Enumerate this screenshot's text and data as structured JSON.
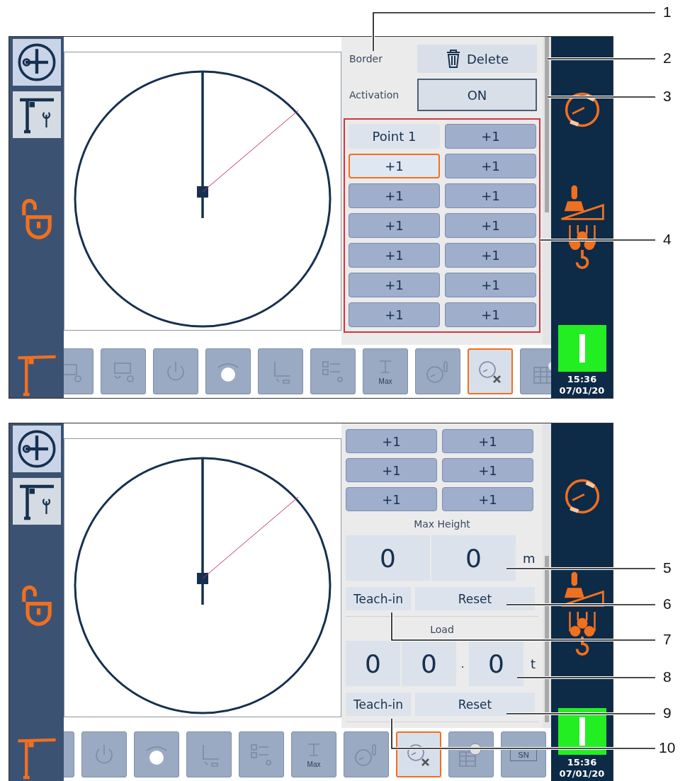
{
  "screens": [
    {
      "sidebar": [
        {
          "selected": true
        },
        {
          "selected": false
        }
      ],
      "panel": {
        "sections": [
          {
            "kind": "action_row",
            "label": "Border",
            "button": "Delete"
          },
          {
            "kind": "toggle_row",
            "label": "Activation",
            "value": "ON"
          },
          {
            "kind": "point_grid",
            "outlined": true,
            "cells": [
              {
                "label": "Point 1",
                "kind": "name",
                "selected": false
              },
              {
                "label": "+1",
                "kind": "step",
                "selected": false
              },
              {
                "label": "+1",
                "kind": "step",
                "selected": true
              },
              {
                "label": "+1",
                "kind": "step",
                "selected": false
              },
              {
                "label": "+1",
                "kind": "step",
                "selected": false
              },
              {
                "label": "+1",
                "kind": "step",
                "selected": false
              },
              {
                "label": "+1",
                "kind": "step",
                "selected": false
              },
              {
                "label": "+1",
                "kind": "step",
                "selected": false
              },
              {
                "label": "+1",
                "kind": "step",
                "selected": false
              },
              {
                "label": "+1",
                "kind": "step",
                "selected": false
              },
              {
                "label": "+1",
                "kind": "step",
                "selected": false
              },
              {
                "label": "+1",
                "kind": "step",
                "selected": false
              },
              {
                "label": "+1",
                "kind": "step",
                "selected": false
              },
              {
                "label": "+1",
                "kind": "step",
                "selected": false
              }
            ]
          }
        ]
      },
      "toolbar": [
        {
          "kind": "winch",
          "selected": false
        },
        {
          "kind": "winch2",
          "selected": false
        },
        {
          "kind": "power",
          "selected": false
        },
        {
          "kind": "kva",
          "selected": false
        },
        {
          "kind": "axes",
          "selected": false
        },
        {
          "kind": "checklist",
          "selected": false
        },
        {
          "kind": "max",
          "label": "Max",
          "selected": false
        },
        {
          "kind": "thermo",
          "selected": false
        },
        {
          "kind": "cross",
          "selected": true
        },
        {
          "kind": "calendar",
          "selected": false
        }
      ],
      "status_lamp": {
        "on": true
      },
      "clock": {
        "time": "15:36",
        "date": "07/01/20"
      }
    },
    {
      "sidebar": [
        {
          "selected": true
        },
        {
          "selected": false
        }
      ],
      "panel": {
        "sections": [
          {
            "kind": "point_grid",
            "outlined": false,
            "cells": [
              {
                "label": "+1",
                "kind": "step",
                "selected": false
              },
              {
                "label": "+1",
                "kind": "step",
                "selected": false
              },
              {
                "label": "+1",
                "kind": "step",
                "selected": false
              },
              {
                "label": "+1",
                "kind": "step",
                "selected": false
              },
              {
                "label": "+1",
                "kind": "step",
                "selected": false
              },
              {
                "label": "+1",
                "kind": "step",
                "selected": false
              }
            ]
          },
          {
            "kind": "digits",
            "label": "Max Height",
            "integer": [
              "0",
              "0"
            ],
            "unit": "m"
          },
          {
            "kind": "teach_row",
            "teach": "Teach-in",
            "reset": "Reset"
          },
          {
            "kind": "digits",
            "label": "Load",
            "integer": [
              "0",
              "0"
            ],
            "separator": ".",
            "fraction": [
              "0"
            ],
            "unit": "t"
          },
          {
            "kind": "teach_row",
            "teach": "Teach-in",
            "reset": "Reset"
          }
        ]
      },
      "toolbar": [
        {
          "kind": "edge",
          "selected": false
        },
        {
          "kind": "power",
          "selected": false
        },
        {
          "kind": "kva",
          "selected": false
        },
        {
          "kind": "axes",
          "selected": false
        },
        {
          "kind": "checklist",
          "selected": false
        },
        {
          "kind": "max",
          "label": "Max",
          "selected": false
        },
        {
          "kind": "thermo",
          "selected": false
        },
        {
          "kind": "cross",
          "selected": true
        },
        {
          "kind": "clockcal",
          "selected": false
        },
        {
          "kind": "plate",
          "label": "SN",
          "selected": false
        }
      ],
      "status_lamp": {
        "on": true
      },
      "clock": {
        "time": "15:36",
        "date": "07/01/20"
      }
    }
  ],
  "callouts": [
    "1",
    "2",
    "3",
    "4",
    "5",
    "6",
    "7",
    "8",
    "9",
    "10"
  ]
}
